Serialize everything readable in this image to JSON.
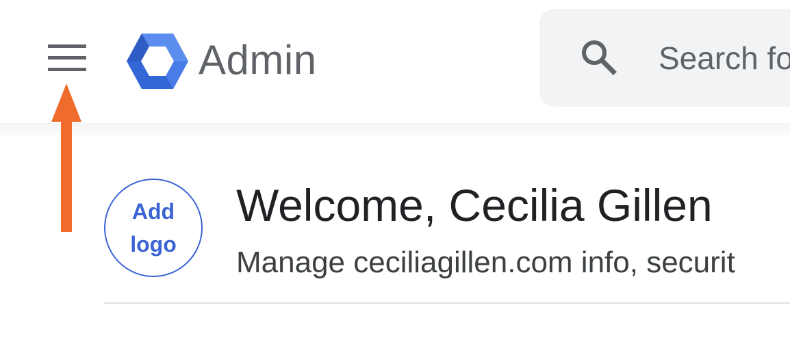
{
  "header": {
    "app_title": "Admin",
    "search": {
      "placeholder": "Search fo"
    },
    "icons": [
      "menu-icon",
      "admin-logo-icon",
      "search-icon"
    ]
  },
  "annotation": {
    "icon": "up-arrow-icon",
    "color": "#ef6c2c"
  },
  "welcome": {
    "logo_placeholder": {
      "line1": "Add",
      "line2": "logo"
    },
    "title": "Welcome, Cecilia Gillen",
    "subtitle": "Manage ceciliagillen.com info, securit"
  },
  "colors": {
    "accent_blue": "#3b63d3",
    "logo_blue_dark": "#3367d6",
    "logo_blue_light": "#5b8def",
    "text_dark": "#202124",
    "text_gray": "#5f6368"
  }
}
